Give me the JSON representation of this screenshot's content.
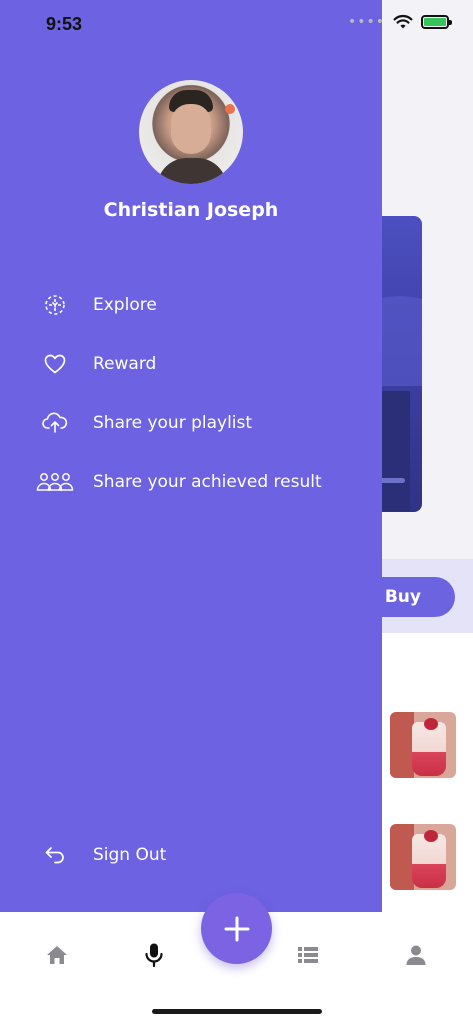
{
  "status_bar": {
    "time": "9:53",
    "battery_color": "#36c45a"
  },
  "drawer": {
    "background_color": "#6d62e1",
    "user": {
      "name": "Christian Joseph"
    },
    "menu": [
      {
        "label": "Explore",
        "icon": "explore-icon"
      },
      {
        "label": "Reward",
        "icon": "heart-icon"
      },
      {
        "label": "Share your playlist",
        "icon": "cloud-upload-icon"
      },
      {
        "label": "Share your achieved result",
        "icon": "users-icon"
      }
    ],
    "sign_out": {
      "label": "Sign Out",
      "icon": "sign-out-icon"
    }
  },
  "background": {
    "buy_button_label": "Buy",
    "accent_color": "#6c63e0"
  },
  "tab_bar": {
    "tabs": [
      {
        "name": "home",
        "icon": "home-icon"
      },
      {
        "name": "mic",
        "icon": "microphone-icon"
      },
      {
        "name": "add",
        "icon": "plus-icon"
      },
      {
        "name": "list",
        "icon": "list-icon"
      },
      {
        "name": "profile",
        "icon": "user-icon"
      }
    ],
    "fab_color": "#7b63e4"
  }
}
